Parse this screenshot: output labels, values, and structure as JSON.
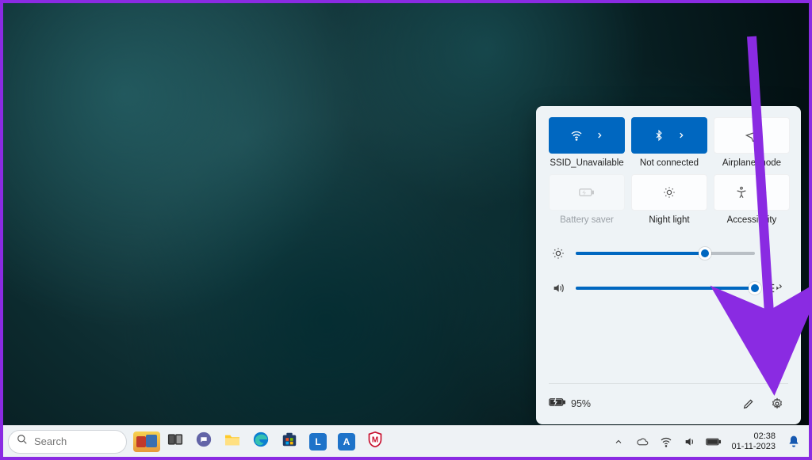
{
  "colors": {
    "accent": "#0067c0",
    "panel": "#eef3f6",
    "arrow": "#8a2be2"
  },
  "quick_settings": {
    "tiles": [
      {
        "key": "wifi",
        "label": "SSID_Unavailable",
        "active": true,
        "expandable": true,
        "icon": "wifi-icon"
      },
      {
        "key": "bluetooth",
        "label": "Not connected",
        "active": true,
        "expandable": true,
        "icon": "bluetooth-icon"
      },
      {
        "key": "airplane",
        "label": "Airplane mode",
        "active": false,
        "expandable": false,
        "icon": "airplane-icon"
      },
      {
        "key": "battery_saver",
        "label": "Battery saver",
        "active": false,
        "disabled": true,
        "icon": "battery-saver-icon"
      },
      {
        "key": "night_light",
        "label": "Night light",
        "active": false,
        "icon": "night-light-icon"
      },
      {
        "key": "accessibility",
        "label": "Accessibility",
        "active": false,
        "expandable": true,
        "icon": "accessibility-icon"
      }
    ],
    "brightness_percent": 72,
    "volume_percent": 100,
    "battery_text": "95%"
  },
  "taskbar": {
    "search_placeholder": "Search",
    "apps": [
      {
        "name": "widgets",
        "icon": "castle-icon"
      },
      {
        "name": "task-view",
        "icon": "task-view-icon"
      },
      {
        "name": "chat",
        "icon": "chat-icon"
      },
      {
        "name": "file-explorer",
        "icon": "file-explorer-icon"
      },
      {
        "name": "edge",
        "icon": "edge-icon"
      },
      {
        "name": "microsoft-store",
        "icon": "store-icon"
      },
      {
        "name": "app-l",
        "icon": "l-icon",
        "letter": "L"
      },
      {
        "name": "app-a",
        "icon": "a-icon",
        "letter": "A"
      },
      {
        "name": "mcafee",
        "icon": "mcafee-icon",
        "letter": "M"
      }
    ],
    "tray": {
      "time": "02:38",
      "date": "01-11-2023"
    }
  }
}
